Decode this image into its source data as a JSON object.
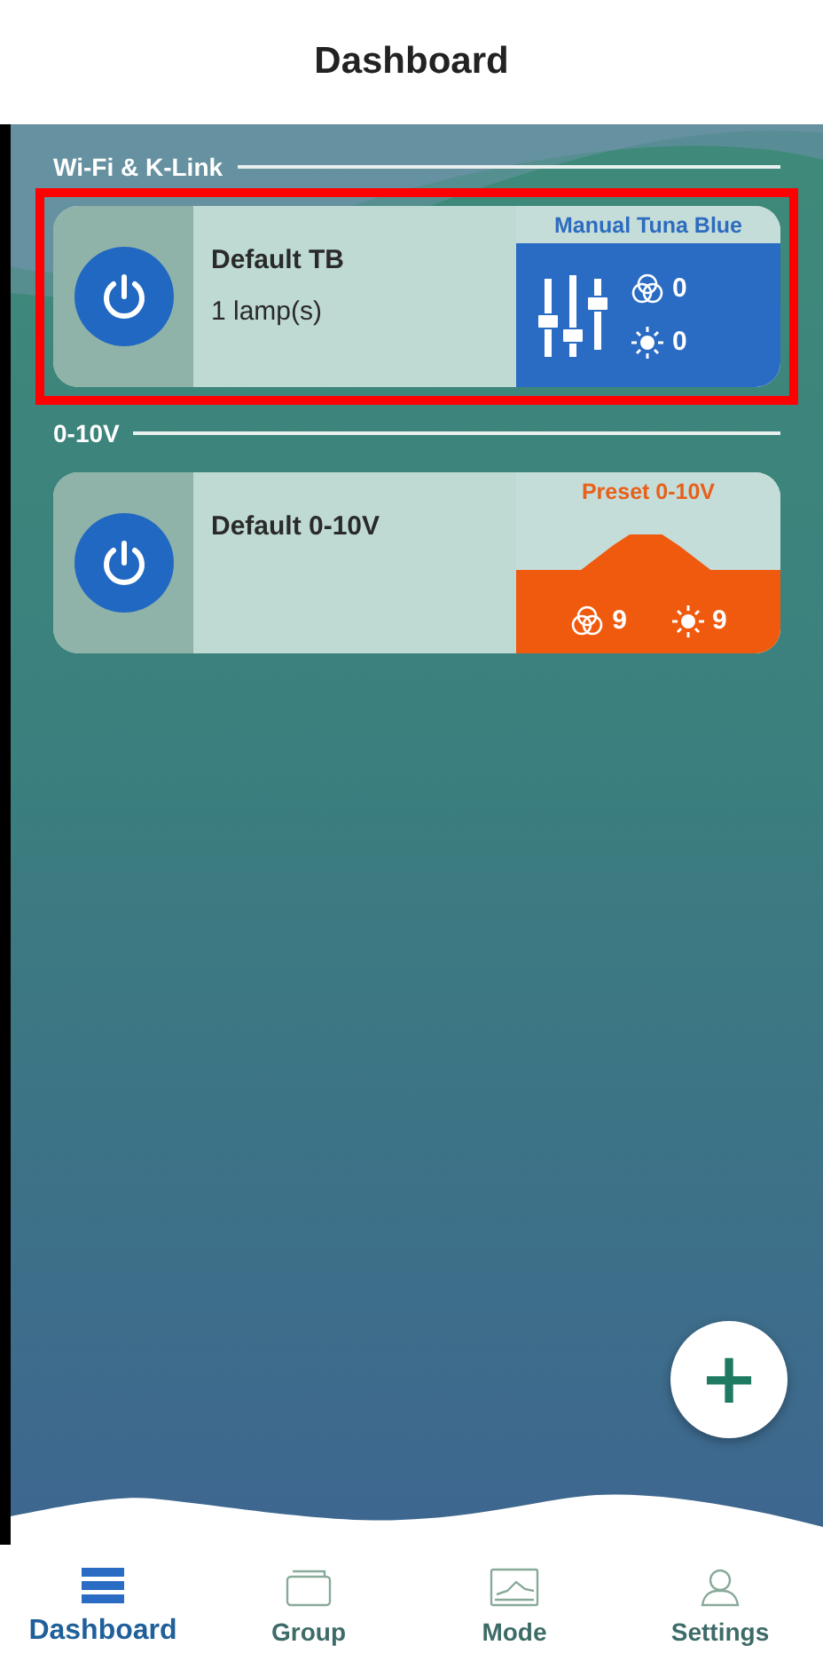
{
  "header": {
    "title": "Dashboard"
  },
  "sections": [
    {
      "title": "Wi-Fi & K-Link",
      "cards": [
        {
          "name": "Default TB",
          "lamps": "1 lamp(s)",
          "highlighted": true,
          "on": true,
          "mode": {
            "kind": "manual",
            "title": "Manual Tuna Blue",
            "color_value": "0",
            "brightness_value": "0"
          }
        }
      ]
    },
    {
      "title": "0-10V",
      "cards": [
        {
          "name": "Default 0-10V",
          "highlighted": false,
          "on": true,
          "mode": {
            "kind": "preset",
            "title": "Preset 0-10V",
            "color_value": "9",
            "brightness_value": "9"
          }
        }
      ]
    }
  ],
  "fab": {
    "label": "+"
  },
  "nav": [
    {
      "label": "Dashboard",
      "kind": "dashboard",
      "selected": true
    },
    {
      "label": "Group",
      "kind": "group",
      "selected": false
    },
    {
      "label": "Mode",
      "kind": "mode",
      "selected": false
    },
    {
      "label": "Settings",
      "kind": "settings",
      "selected": false
    }
  ]
}
